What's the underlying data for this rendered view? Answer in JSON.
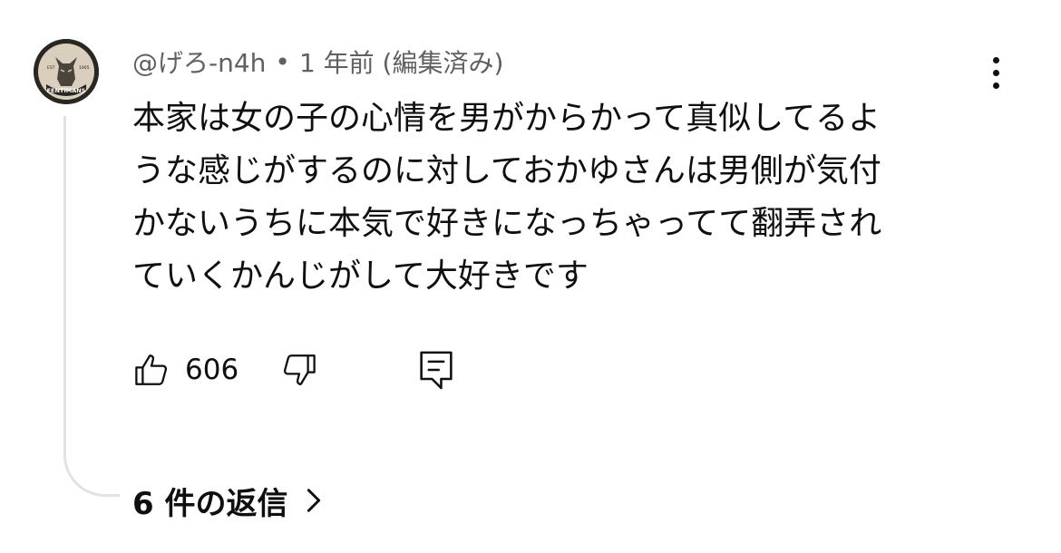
{
  "comment": {
    "author": "@げろ-n4h",
    "separator": "•",
    "timestamp": "1 年前 (編集済み)",
    "text": "本家は女の子の心情を男がからかって真似してるよ\nうな感じがするのに対しておかゆさんは男側が気付\nかないうちに本気で好きになっちゃってて翻弄され\nていくかんじがして大好きです",
    "avatar_text_top": "EST",
    "avatar_text_year": "1905",
    "avatar_text_brand": "FENTIMANS"
  },
  "actions": {
    "like_icon": "thumb-up-icon",
    "like_count": "606",
    "dislike_icon": "thumb-down-icon",
    "reply_icon": "comment-icon",
    "more_icon": "more-vert-icon"
  },
  "replies": {
    "label": "6 件の返信",
    "chevron_icon": "chevron-right-icon"
  }
}
